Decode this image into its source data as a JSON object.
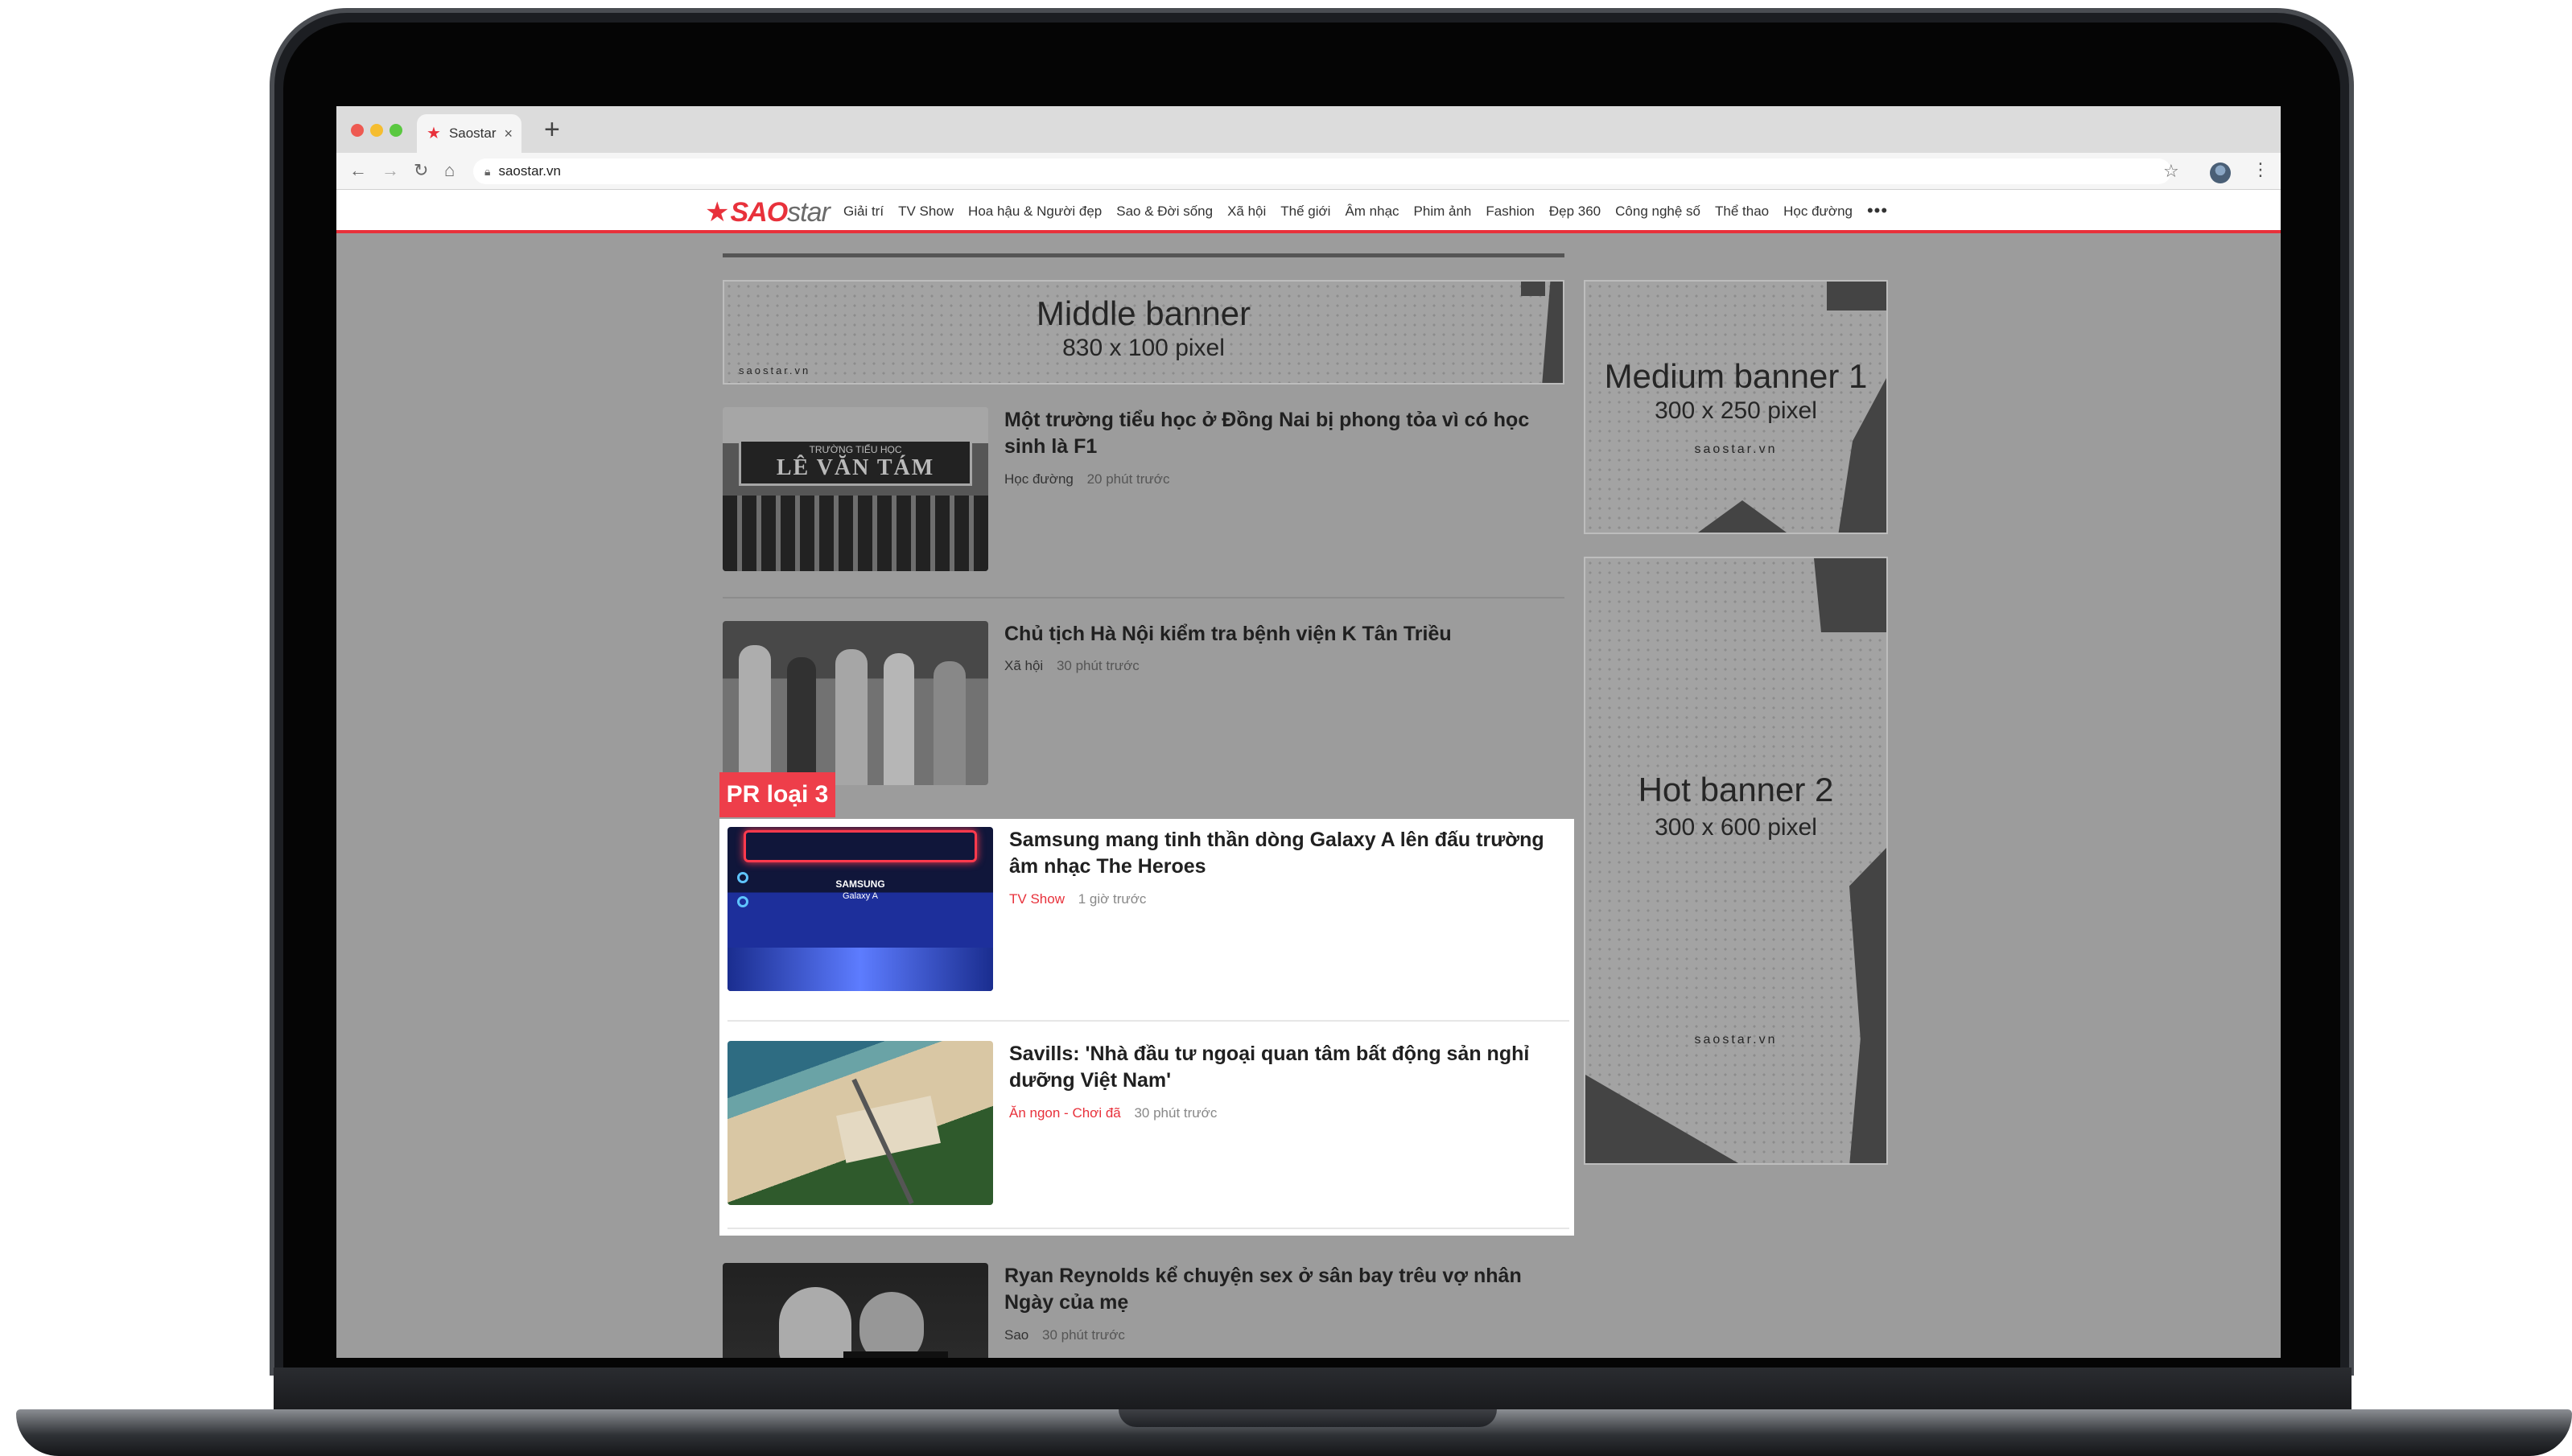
{
  "browser": {
    "tab_title": "Saostar",
    "tab_favicon": "star-icon",
    "url": "saostar.vn"
  },
  "site": {
    "logo_sao": "SAO",
    "logo_star": "star",
    "brand_color": "#e8313b",
    "nav": [
      "Giải trí",
      "TV Show",
      "Hoa hậu & Người đẹp",
      "Sao & Đời sống",
      "Xã hội",
      "Thế giới",
      "Âm nhạc",
      "Phim ảnh",
      "Fashion",
      "Đẹp 360",
      "Công nghệ số",
      "Thể thao",
      "Học đường"
    ],
    "nav_more": "•••"
  },
  "banners": {
    "middle": {
      "title": "Middle banner",
      "size": "830 x 100 pixel",
      "brand": "saostar.vn"
    },
    "medium": {
      "title": "Medium banner 1",
      "size": "300 x 250 pixel",
      "brand": "saostar.vn"
    },
    "hot": {
      "title": "Hot banner 2",
      "size": "300 x 600 pixel",
      "brand": "saostar.vn"
    }
  },
  "pr_label": "PR loại 3",
  "articles": [
    {
      "title": "Một trường tiểu học ở Đồng Nai bị phong tỏa vì có học sinh là F1",
      "category": "Học đường",
      "time": "20 phút trước",
      "thumb_text_top": "TRƯỜNG TIỂU HỌC",
      "thumb_text": "LÊ VĂN TÁM"
    },
    {
      "title": "Chủ tịch Hà Nội kiểm tra bệnh viện K Tân Triều",
      "category": "Xã hội",
      "time": "30 phút trước"
    },
    {
      "title": "Samsung mang tinh thần dòng Galaxy A lên đấu trường âm nhạc The Heroes",
      "category": "TV Show",
      "time": "1 giờ trước",
      "thumb_text": "SAMSUNG",
      "thumb_sub": "Galaxy A"
    },
    {
      "title": "Savills: 'Nhà đầu tư ngoại quan tâm bất động sản nghỉ dưỡng Việt Nam'",
      "category": "Ăn ngon - Chơi đã",
      "time": "30 phút trước"
    },
    {
      "title": "Ryan Reynolds kể chuyện sex ở sân bay trêu vợ nhân Ngày của mẹ",
      "category": "Sao",
      "time": "30 phút trước"
    }
  ]
}
